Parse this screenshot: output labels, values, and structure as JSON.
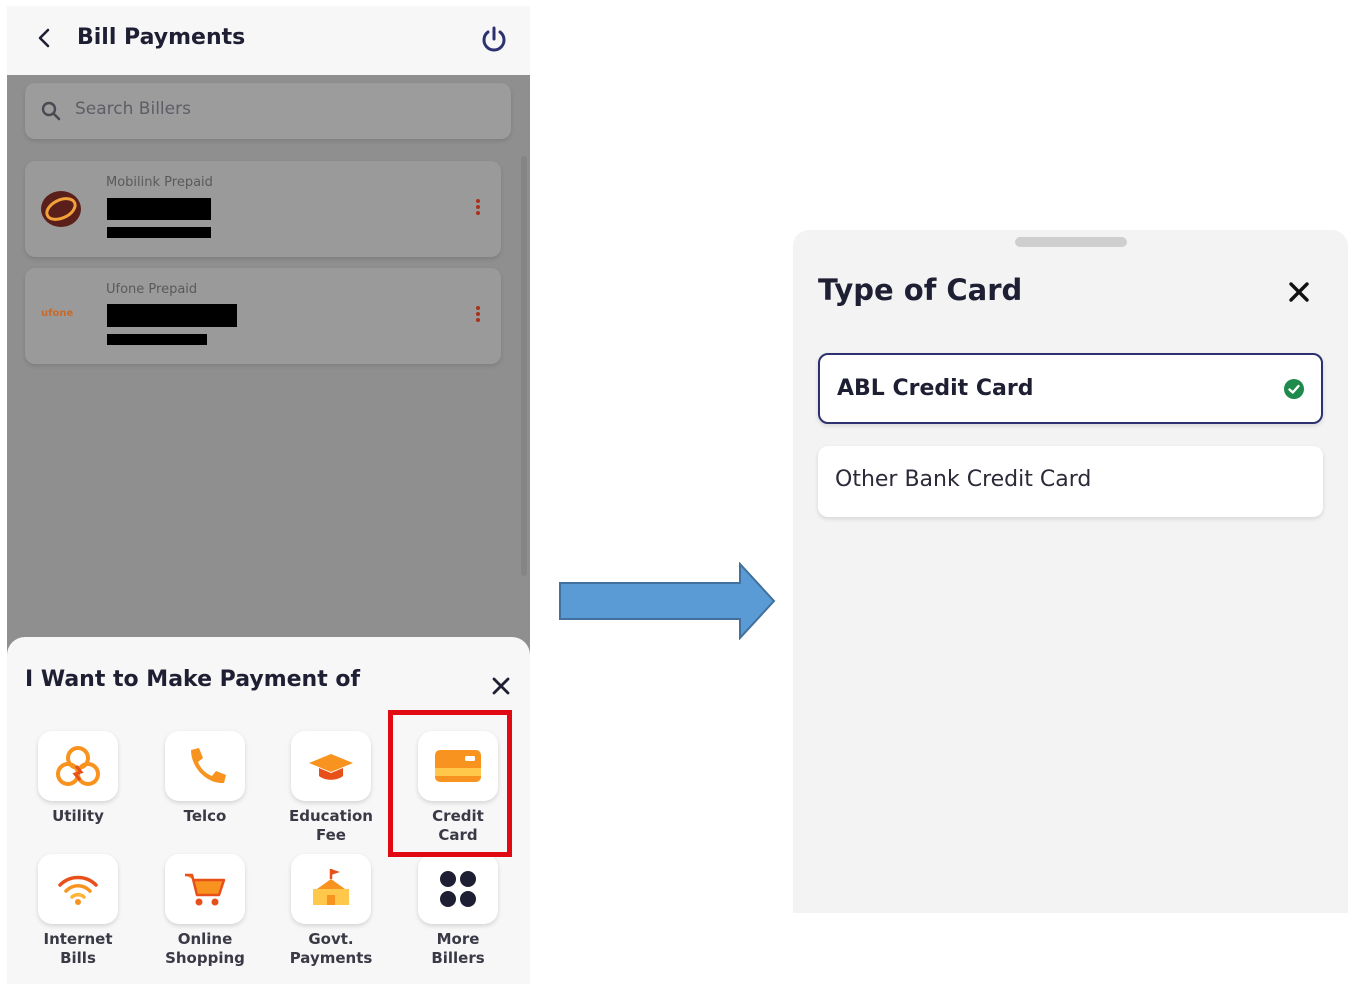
{
  "left_screen": {
    "header": {
      "title": "Bill Payments"
    },
    "search": {
      "placeholder": "Search Billers"
    },
    "billers": [
      {
        "name": "Mobilink Prepaid",
        "logo": "jazz-logo"
      },
      {
        "name": "Ufone Prepaid",
        "logo": "ufone-logo",
        "logo_text": "ufone"
      }
    ],
    "sheet": {
      "title": "I Want to Make Payment of",
      "categories": [
        {
          "label": "Utility",
          "icon": "utility-icon"
        },
        {
          "label": "Telco",
          "icon": "phone-icon"
        },
        {
          "label": "Education\nFee",
          "icon": "graduation-cap-icon"
        },
        {
          "label": "Credit\nCard",
          "icon": "credit-card-icon"
        },
        {
          "label": "Internet\nBills",
          "icon": "wifi-icon"
        },
        {
          "label": "Online\nShopping",
          "icon": "shopping-cart-icon"
        },
        {
          "label": "Govt.\nPayments",
          "icon": "government-building-icon"
        },
        {
          "label": "More\nBillers",
          "icon": "more-grid-icon"
        }
      ],
      "highlighted_category": "Credit\nCard"
    }
  },
  "right_screen": {
    "title": "Type of Card",
    "options": [
      {
        "label": "ABL Credit Card",
        "selected": true
      },
      {
        "label": "Other Bank Credit Card",
        "selected": false
      }
    ]
  },
  "colors": {
    "accent_orange": "#f7931e",
    "highlight_red": "#e10a12",
    "arrow_blue": "#5b9bd5",
    "check_green": "#1e8a4c",
    "selected_border": "#2c3170"
  }
}
